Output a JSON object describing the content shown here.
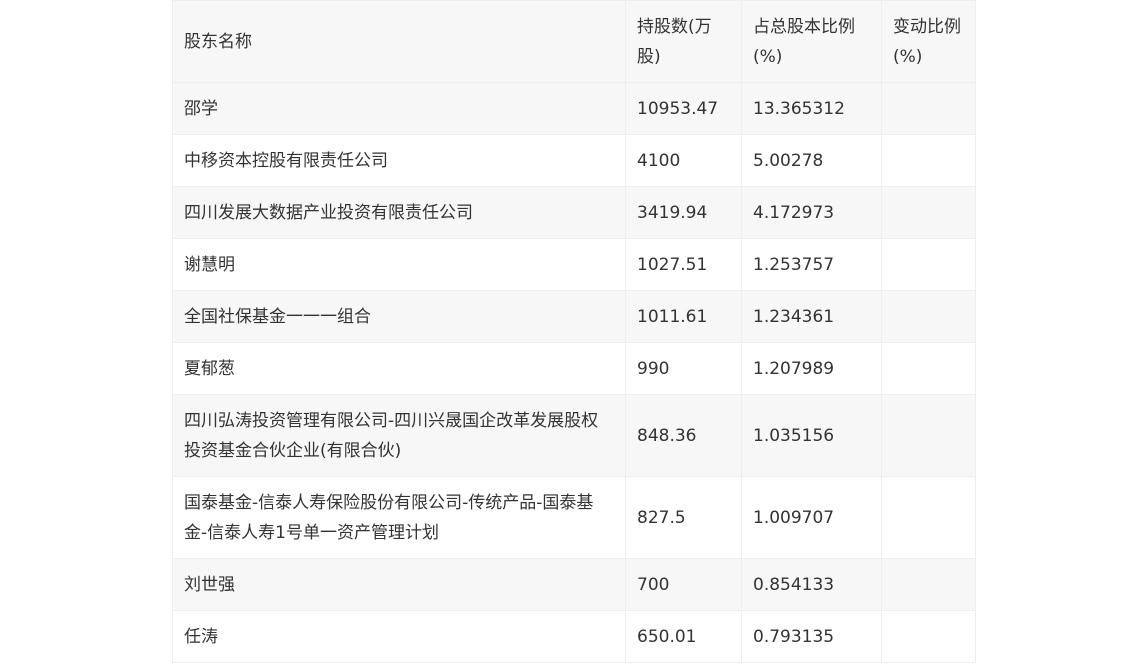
{
  "table": {
    "headers": {
      "name": "股东名称",
      "shares": "持股数(万股)",
      "ratio": "占总股本比例(%)",
      "change": "变动比例(%)"
    },
    "rows": [
      {
        "name": "邵学",
        "shares": "10953.47",
        "ratio": "13.365312",
        "change": ""
      },
      {
        "name": "中移资本控股有限责任公司",
        "shares": "4100",
        "ratio": "5.00278",
        "change": ""
      },
      {
        "name": "四川发展大数据产业投资有限责任公司",
        "shares": "3419.94",
        "ratio": "4.172973",
        "change": ""
      },
      {
        "name": "谢慧明",
        "shares": "1027.51",
        "ratio": "1.253757",
        "change": ""
      },
      {
        "name": "全国社保基金一一一组合",
        "shares": "1011.61",
        "ratio": "1.234361",
        "change": ""
      },
      {
        "name": "夏郁葱",
        "shares": "990",
        "ratio": "1.207989",
        "change": ""
      },
      {
        "name": "四川弘涛投资管理有限公司-四川兴晟国企改革发展股权投资基金合伙企业(有限合伙)",
        "shares": "848.36",
        "ratio": "1.035156",
        "change": ""
      },
      {
        "name": "国泰基金-信泰人寿保险股份有限公司-传统产品-国泰基金-信泰人寿1号单一资产管理计划",
        "shares": "827.5",
        "ratio": "1.009707",
        "change": ""
      },
      {
        "name": "刘世强",
        "shares": "700",
        "ratio": "0.854133",
        "change": ""
      },
      {
        "name": "任涛",
        "shares": "650.01",
        "ratio": "0.793135",
        "change": ""
      }
    ]
  }
}
